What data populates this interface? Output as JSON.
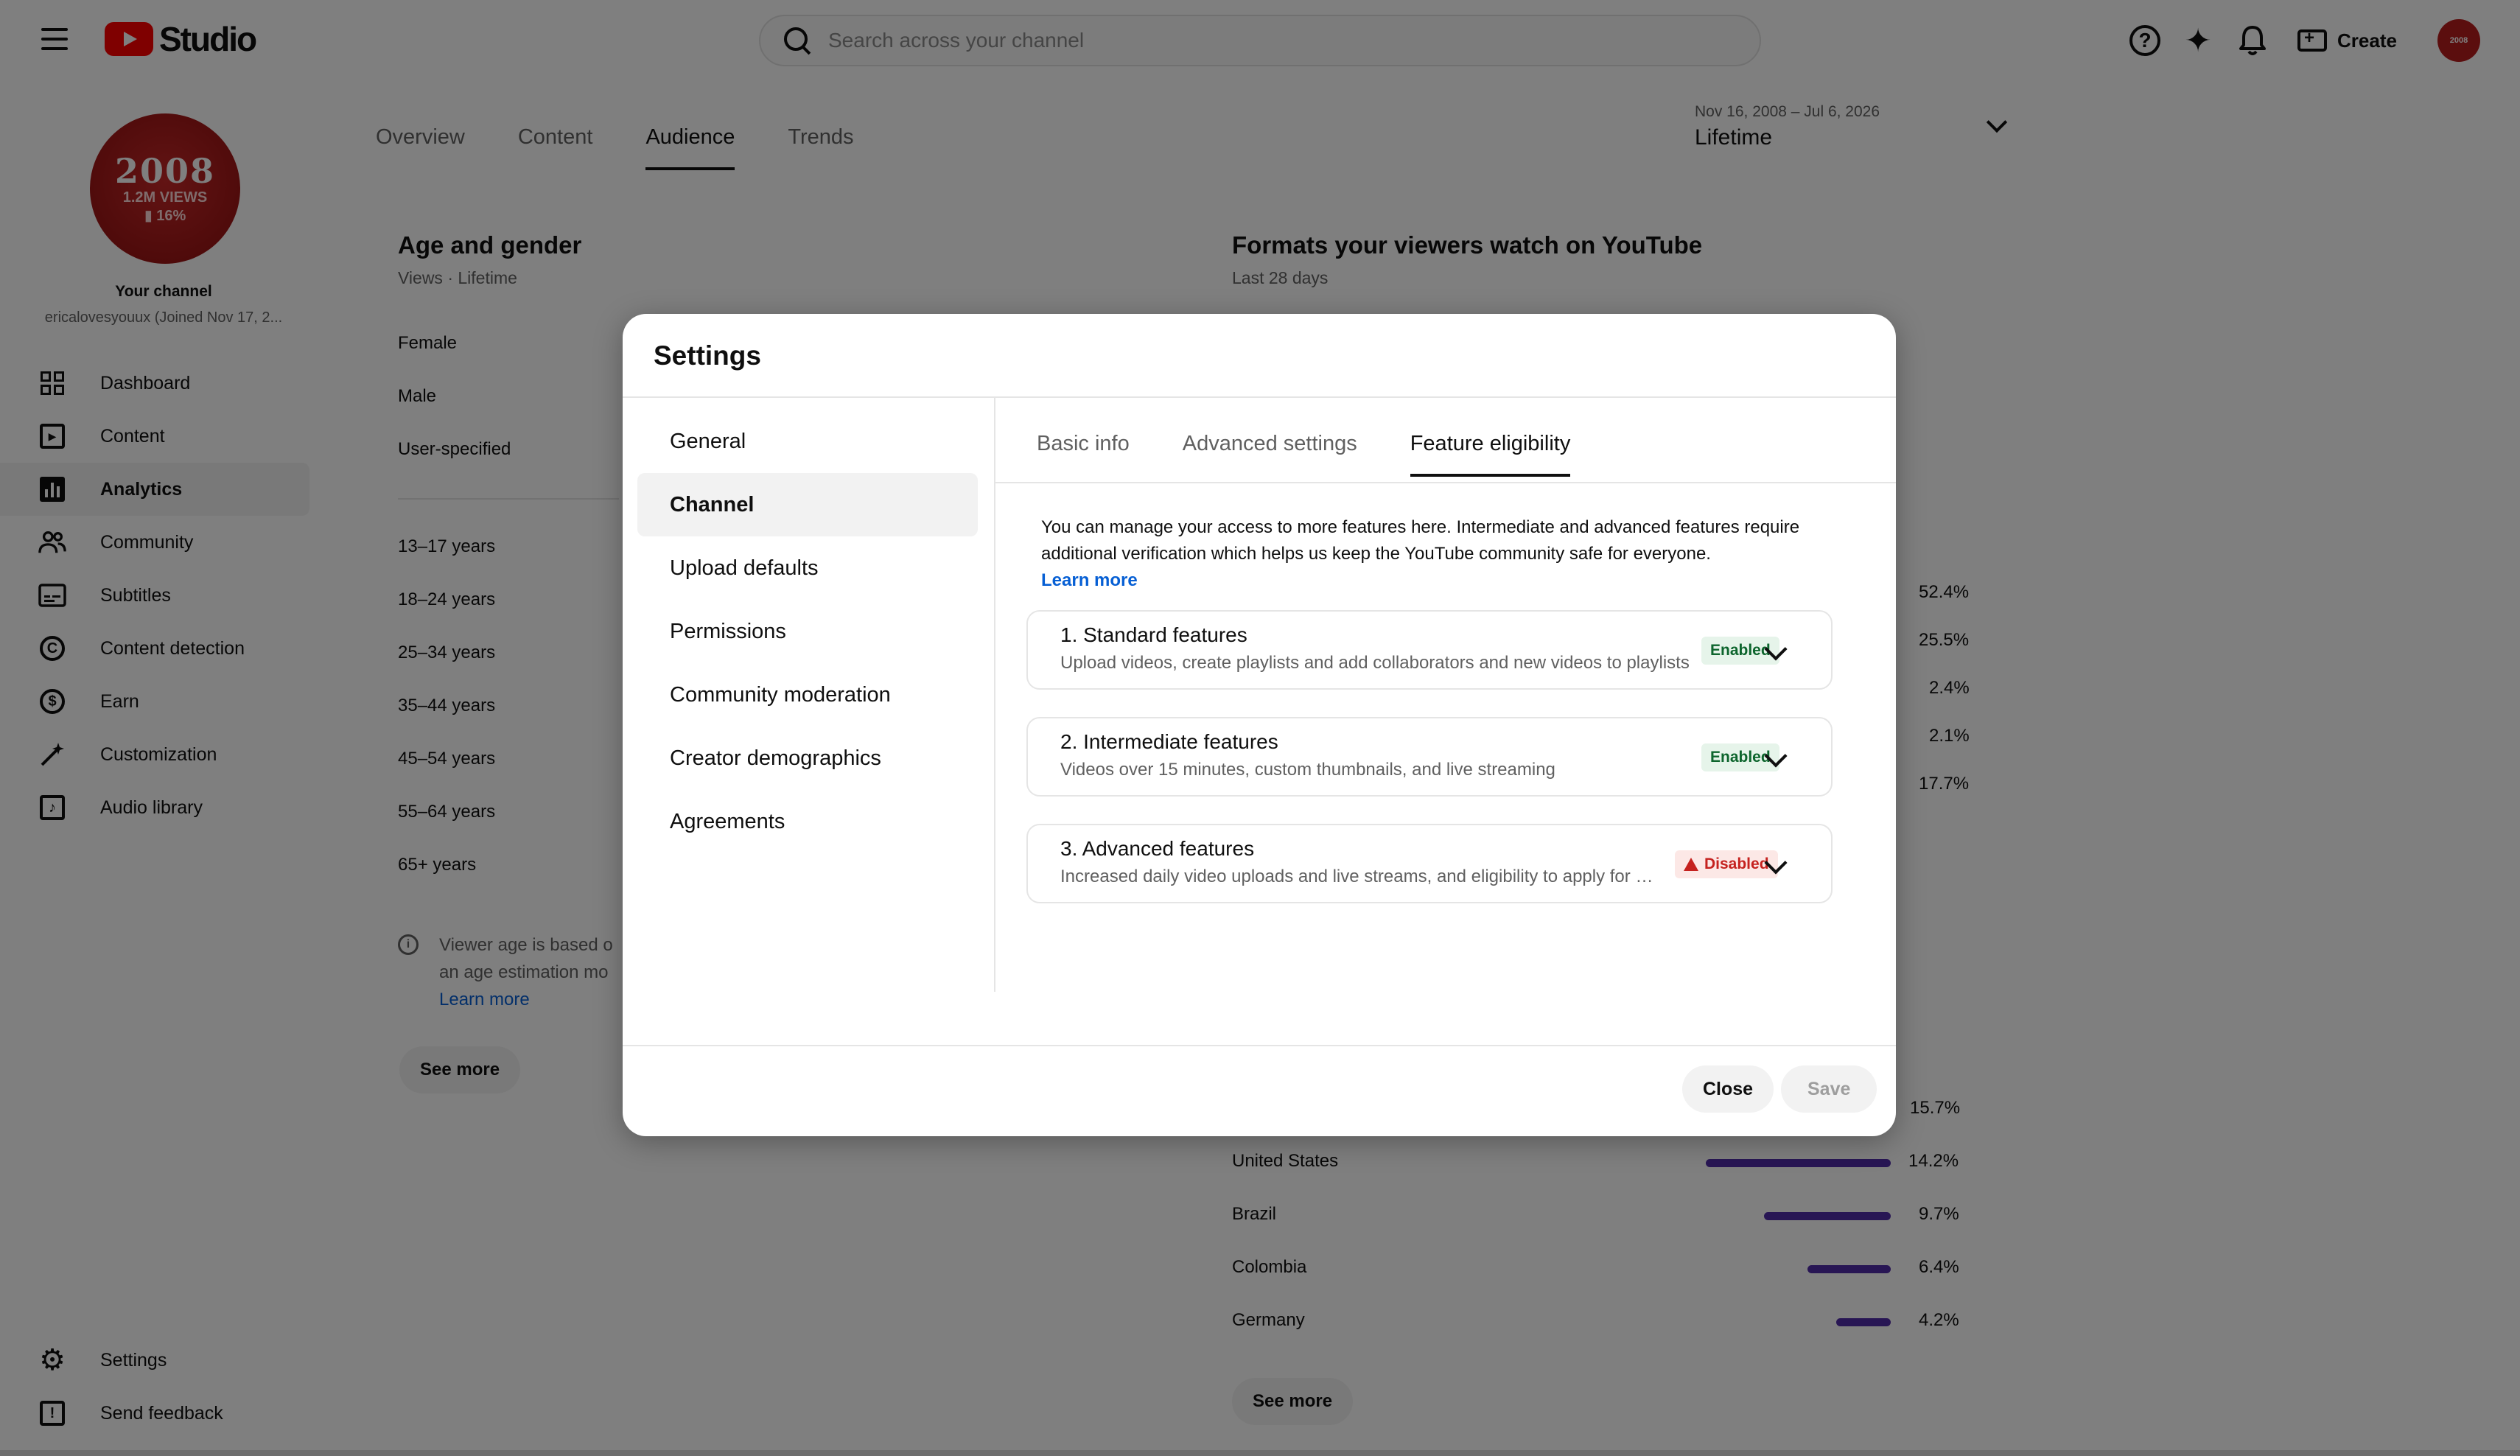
{
  "header": {
    "logo_text": "Studio",
    "search_placeholder": "Search across your channel",
    "create_label": "Create",
    "avatar_text": "2008"
  },
  "sidebar": {
    "avatar": {
      "line1": "2008",
      "line2": "1.2M VIEWS",
      "line3": "▮ 16%"
    },
    "your_channel": "Your channel",
    "channel_sub": "ericalovesyouux (Joined Nov 17, 2...",
    "items": [
      {
        "label": "Dashboard",
        "icon": "dashboard-icon"
      },
      {
        "label": "Content",
        "icon": "content-icon"
      },
      {
        "label": "Analytics",
        "icon": "analytics-icon"
      },
      {
        "label": "Community",
        "icon": "community-icon"
      },
      {
        "label": "Subtitles",
        "icon": "subtitles-icon"
      },
      {
        "label": "Content detection",
        "icon": "copyright-icon"
      },
      {
        "label": "Earn",
        "icon": "dollar-icon"
      },
      {
        "label": "Customization",
        "icon": "magic-wand-icon"
      },
      {
        "label": "Audio library",
        "icon": "audio-library-icon"
      }
    ],
    "active_item": "Analytics",
    "bottom_items": [
      {
        "label": "Settings",
        "icon": "gear-icon"
      },
      {
        "label": "Send feedback",
        "icon": "feedback-icon"
      }
    ]
  },
  "main": {
    "tabs": [
      "Overview",
      "Content",
      "Audience",
      "Trends"
    ],
    "active_tab": "Audience",
    "date_range": "Nov 16, 2008 – Jul 6, 2026",
    "date_value": "Lifetime",
    "age_gender": {
      "title": "Age and gender",
      "subtitle": "Views · Lifetime",
      "genders": [
        "Female",
        "Male",
        "User-specified"
      ],
      "ages": [
        "13–17 years",
        "18–24 years",
        "25–34 years",
        "35–44 years",
        "45–54 years",
        "55–64 years",
        "65+ years"
      ],
      "note_text": "Viewer age is based o",
      "note_text2": "an age estimation mo",
      "note_link": "Learn more",
      "see_more": "See more"
    },
    "formats": {
      "title": "Formats your viewers watch on YouTube",
      "subtitle": "Last 28 days",
      "percents": [
        "52.4%",
        "25.5%",
        "2.4%",
        "2.1%",
        "17.7%"
      ]
    },
    "geography": {
      "first_percent": "15.7%",
      "rows": [
        {
          "country": "United States",
          "percent": "14.2%",
          "value": 14.2
        },
        {
          "country": "Brazil",
          "percent": "9.7%",
          "value": 9.7
        },
        {
          "country": "Colombia",
          "percent": "6.4%",
          "value": 6.4
        },
        {
          "country": "Germany",
          "percent": "4.2%",
          "value": 4.2
        }
      ],
      "see_more": "See more"
    }
  },
  "modal": {
    "title": "Settings",
    "nav": [
      "General",
      "Channel",
      "Upload defaults",
      "Permissions",
      "Community moderation",
      "Creator demographics",
      "Agreements"
    ],
    "active_nav": "Channel",
    "tabs": [
      "Basic info",
      "Advanced settings",
      "Feature eligibility"
    ],
    "active_tab": "Feature eligibility",
    "description": "You can manage your access to more features here. Intermediate and advanced features require additional verification which helps us keep the YouTube community safe for everyone.",
    "learn_more": "Learn more",
    "features": [
      {
        "title": "1. Standard features",
        "desc": "Upload videos, create playlists and add collaborators and new videos to playlists",
        "status": "Enabled",
        "state": "enabled"
      },
      {
        "title": "2. Intermediate features",
        "desc": "Videos over 15 minutes, custom thumbnails, and live streaming",
        "status": "Enabled",
        "state": "enabled"
      },
      {
        "title": "3. Advanced features",
        "desc": "Increased daily video uploads and live streams, and eligibility to apply for monetization",
        "status": "Disabled",
        "state": "disabled"
      }
    ],
    "close_label": "Close",
    "save_label": "Save"
  }
}
